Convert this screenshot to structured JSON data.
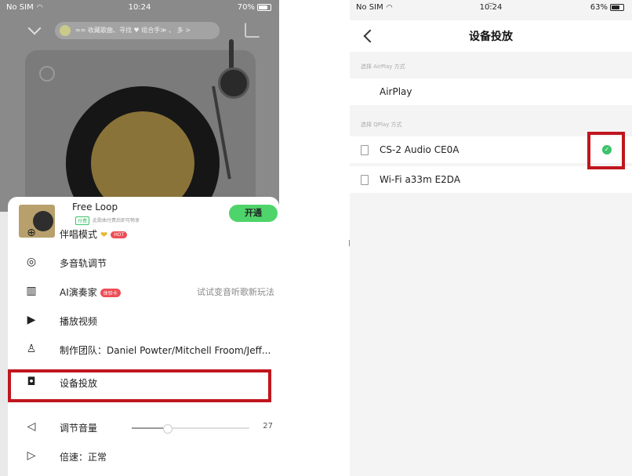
{
  "left": {
    "status": {
      "carrier": "No SIM",
      "time": "10:24",
      "battery": "70%"
    },
    "search_text": "≈≈ 收藏歌曲、寻找 ♥ 组合手≫ 、 多 >",
    "song": {
      "title": "Free Loop",
      "tag": "付费",
      "subtitle": "此歌曲付费后即可畅享",
      "open_label": "开通"
    },
    "menu": [
      {
        "label": "伴唱模式",
        "badge": "HOT",
        "icon": "karaoke-icon"
      },
      {
        "label": "多音轨调节",
        "icon": "multitrack-icon"
      },
      {
        "label": "AI演奏家",
        "badge": "体验卡",
        "right": "试试变音听歌新玩法",
        "icon": "piano-icon"
      },
      {
        "label": "播放视频",
        "icon": "play-video-icon"
      },
      {
        "label": "制作团队：Daniel Powter/Mitchell Froom/Jeff...",
        "icon": "team-icon"
      },
      {
        "label": "设备投放",
        "icon": "cast-icon"
      },
      {
        "label": "调节音量",
        "icon": "volume-icon",
        "value": "27"
      },
      {
        "label": "倍速：正常",
        "icon": "speed-icon"
      }
    ],
    "volume_level": 0.3,
    "highlight_color": "#c0161e"
  },
  "right": {
    "status": {
      "carrier": "No SIM",
      "time": "10:24",
      "battery": "63%"
    },
    "title": "设备投放",
    "airplay_header": "选择 AirPlay 方式",
    "airplay_item": "AirPlay",
    "qplay_header": "选择 QPlay 方式",
    "devices": [
      {
        "name": "CS-2 Audio CE0A",
        "selected": true
      },
      {
        "name": "Wi-Fi a33m E2DA",
        "selected": false
      }
    ],
    "accent": "#3cc26a"
  }
}
